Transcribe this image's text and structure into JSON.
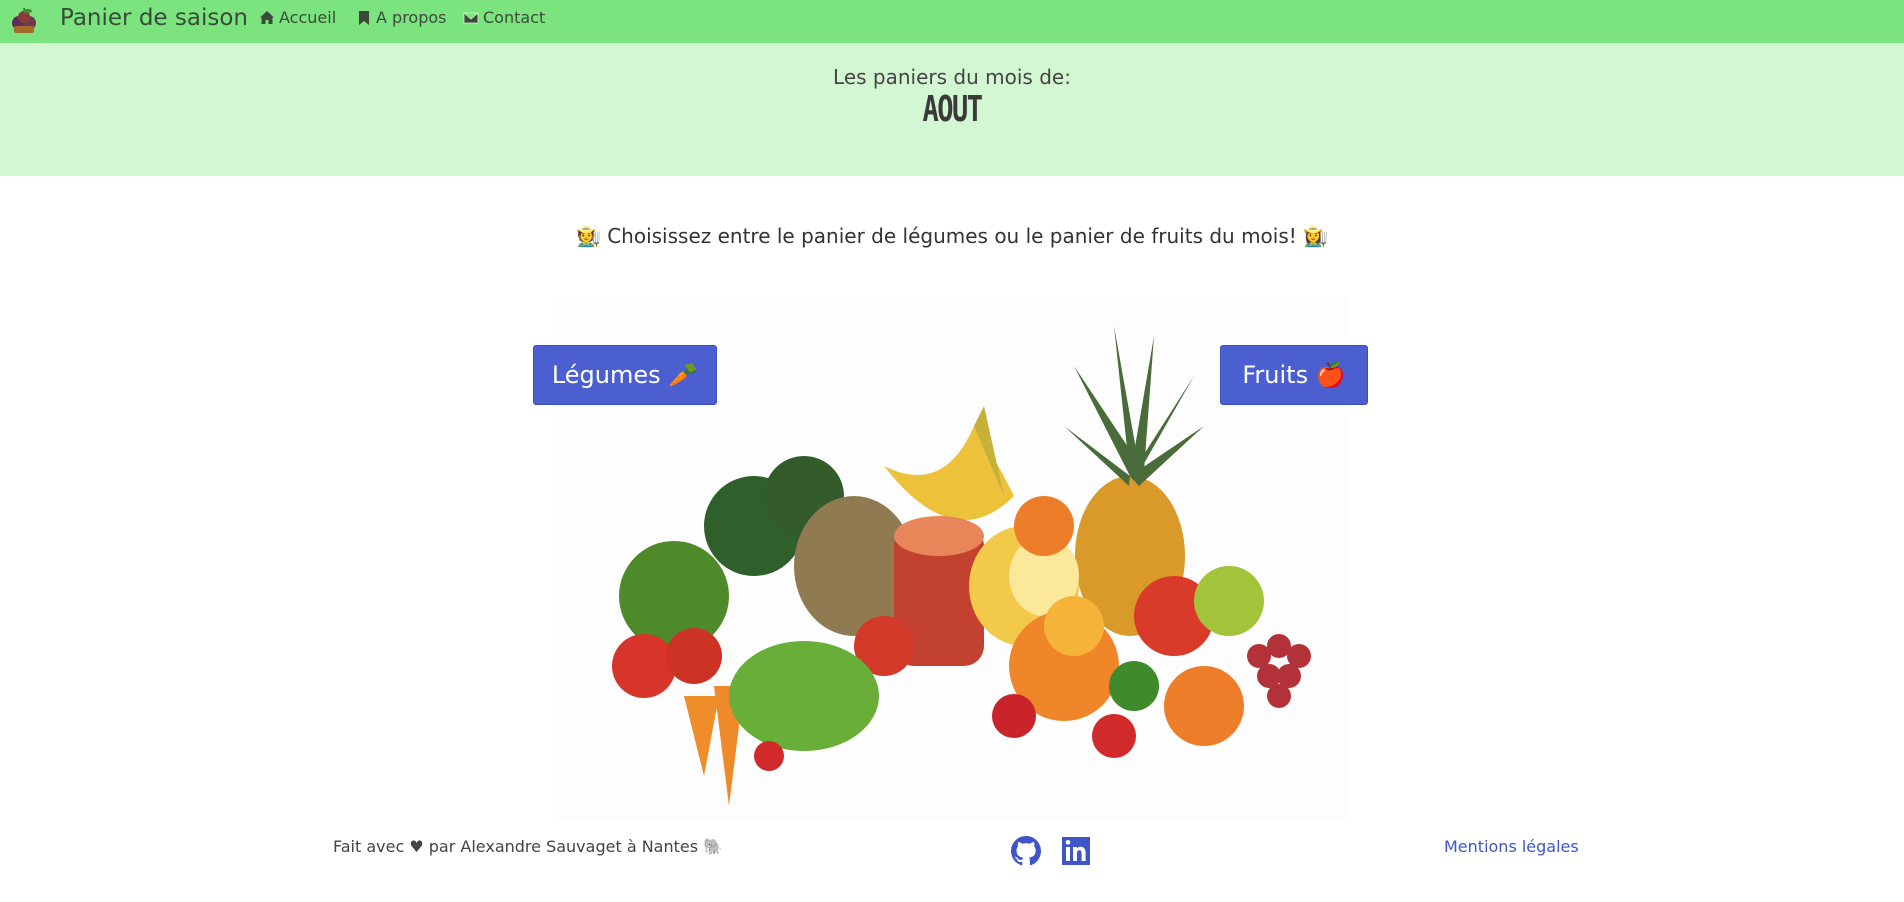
{
  "navbar": {
    "brand": "Panier de saison",
    "logo_icon": "fruit-basket-icon",
    "items": [
      {
        "label": "Accueil",
        "icon": "home-icon"
      },
      {
        "label": "A propos",
        "icon": "bookmark-icon"
      },
      {
        "label": "Contact",
        "icon": "envelope-icon"
      }
    ]
  },
  "hero": {
    "subtitle": "Les paniers du mois de:",
    "month": "AOUT"
  },
  "main": {
    "lead": "🧑‍🌾 Choisissez entre le panier de légumes ou le panier de fruits du mois! 👩‍🌾",
    "buttons": {
      "legumes": "Légumes 🥕",
      "fruits": "Fruits 🍎"
    },
    "image_icon": "fruits-and-vegetables-illustration"
  },
  "footer": {
    "credit": "Fait avec ♥ par Alexandre Sauvaget à Nantes 🐘",
    "icons": [
      "github-icon",
      "linkedin-icon"
    ],
    "legal": "Mentions légales"
  },
  "colors": {
    "navbar_bg": "#7ce47f",
    "hero_bg": "#d3f7d3",
    "primary": "#4b5fd1",
    "link": "#3f55c9"
  }
}
